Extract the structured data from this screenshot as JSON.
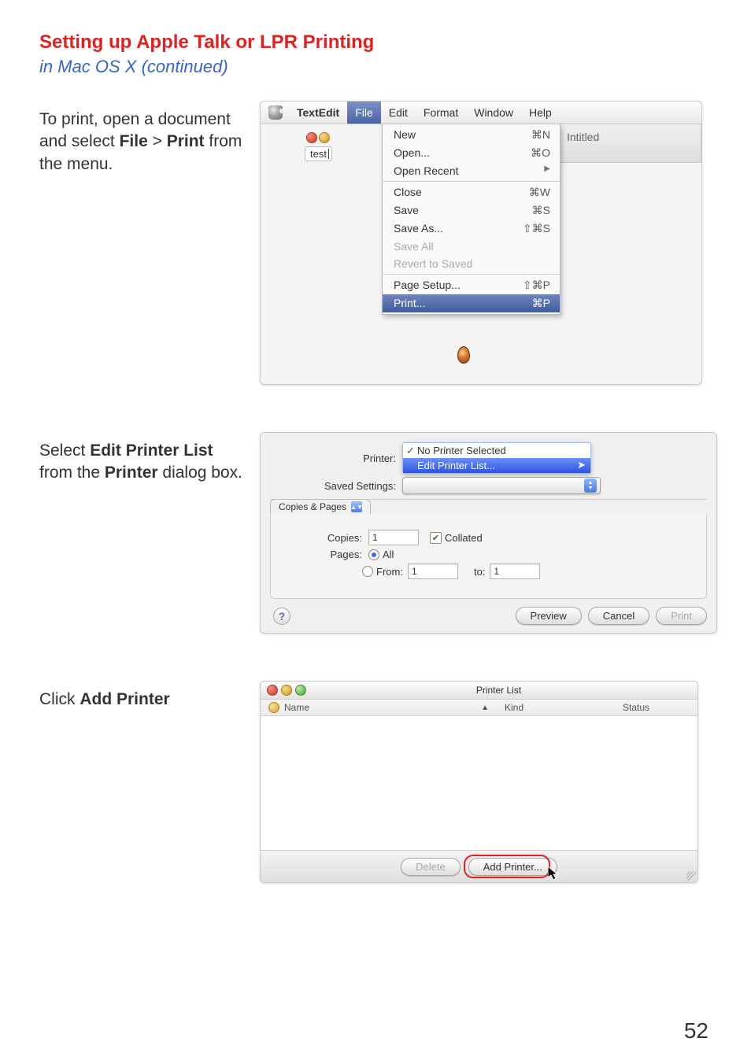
{
  "page": {
    "title": "Setting up Apple Talk or LPR Printing",
    "subtitle": "in Mac OS X (continued)",
    "number": "52"
  },
  "step1": {
    "instr_pre": "To print, open a document and select ",
    "instr_file": "File",
    "instr_gt": " > ",
    "instr_print": "Print",
    "instr_post": " from the menu.",
    "menubar": {
      "app": "TextEdit",
      "file": "File",
      "edit": "Edit",
      "format": "Format",
      "window": "Window",
      "help": "Help"
    },
    "doc_label": "test",
    "bg_win_title": "Intitled",
    "menu": {
      "new": "New",
      "new_sc": "⌘N",
      "open": "Open...",
      "open_sc": "⌘O",
      "open_recent": "Open Recent",
      "close": "Close",
      "close_sc": "⌘W",
      "save": "Save",
      "save_sc": "⌘S",
      "save_as": "Save As...",
      "save_as_sc": "⇧⌘S",
      "save_all": "Save All",
      "revert": "Revert to Saved",
      "page_setup": "Page Setup...",
      "page_setup_sc": "⇧⌘P",
      "print": "Print...",
      "print_sc": "⌘P"
    }
  },
  "step2": {
    "instr_pre": "Select ",
    "instr_epl": "Edit Printer List",
    "instr_mid": " from the ",
    "instr_printer": "Printer",
    "instr_post": " dialog box.",
    "dialog": {
      "printer_label": "Printer:",
      "no_printer": "No Printer Selected",
      "edit_list": "Edit Printer List...",
      "saved_label": "Saved Settings:",
      "section_tab": "Copies & Pages",
      "copies_label": "Copies:",
      "copies_val": "1",
      "collated": "Collated",
      "pages_label": "Pages:",
      "all": "All",
      "from_label": "From:",
      "from_val": "1",
      "to_label": "to:",
      "to_val": "1",
      "preview": "Preview",
      "cancel": "Cancel",
      "print": "Print"
    }
  },
  "step3": {
    "instr_pre": "Click  ",
    "instr_add": "Add Printer",
    "window": {
      "title": "Printer List",
      "col_name": "Name",
      "col_kind": "Kind",
      "col_status": "Status",
      "delete": "Delete",
      "add": "Add Printer..."
    }
  }
}
